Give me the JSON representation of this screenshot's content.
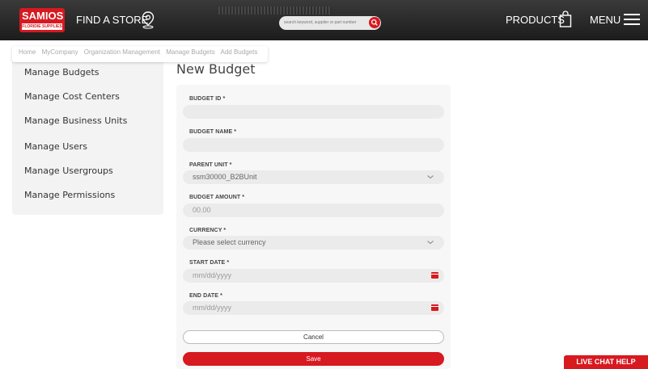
{
  "header": {
    "logo_text": "SAMIOS",
    "logo_sub": "FLORIDIE SUPPLIES",
    "find_store": "FIND A STORE",
    "search_placeholder": "search keyword, supplier or part number",
    "products": "PRODUCTS",
    "menu": "MENU"
  },
  "breadcrumb": [
    "Home",
    "MyCompany",
    "Organization Management",
    "Manage Budgets",
    "Add Budgets"
  ],
  "sidebar": {
    "items": [
      {
        "label": "Manage Budgets"
      },
      {
        "label": "Manage Cost Centers"
      },
      {
        "label": "Manage Business Units"
      },
      {
        "label": "Manage Users"
      },
      {
        "label": "Manage Usergroups"
      },
      {
        "label": "Manage Permissions"
      }
    ]
  },
  "page": {
    "title": "New Budget"
  },
  "form": {
    "budget_id": {
      "label": "BUDGET ID *",
      "value": ""
    },
    "budget_name": {
      "label": "BUDGET NAME *",
      "value": ""
    },
    "parent_unit": {
      "label": "PARENT UNIT *",
      "value": "ssm30000_B2BUnit"
    },
    "budget_amount": {
      "label": "BUDGET AMOUNT *",
      "value": "00.00"
    },
    "currency": {
      "label": "CURRENCY *",
      "value": "Please select currency"
    },
    "start_date": {
      "label": "START DATE *",
      "placeholder": "mm/dd/yyyy"
    },
    "end_date": {
      "label": "END DATE *",
      "placeholder": "mm/dd/yyyy"
    },
    "cancel_label": "Cancel",
    "save_label": "Save"
  },
  "livechat": "LIVE CHAT HELP",
  "colors": {
    "brand_red": "#d71920",
    "header_bg": "#222222"
  }
}
